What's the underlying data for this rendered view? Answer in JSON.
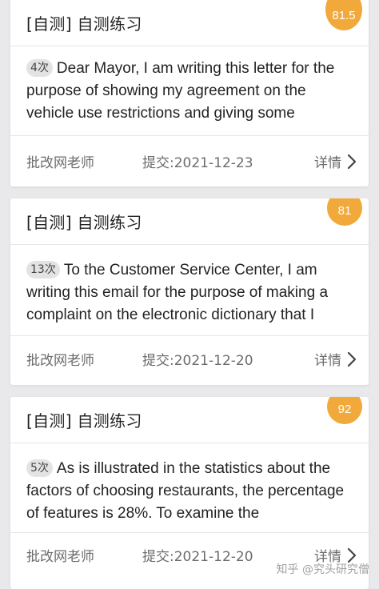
{
  "accent_color": "#f2a93b",
  "cards": [
    {
      "title": "[自测] 自测练习",
      "score": "81.5",
      "count": "4次",
      "excerpt": "Dear Mayor, I am writing this letter for the purpose of showing my agreement on the vehicle use restrictions and giving some",
      "teacher": "批改网老师",
      "submitted": "提交:2021-12-23",
      "detail": "详情"
    },
    {
      "title": "[自测] 自测练习",
      "score": "81",
      "count": "13次",
      "excerpt": "To the Customer Service Center, I am writing this email for the purpose of making a complaint on the electronic dictionary that I",
      "teacher": "批改网老师",
      "submitted": "提交:2021-12-20",
      "detail": "详情"
    },
    {
      "title": "[自测] 自测练习",
      "score": "92",
      "count": "5次",
      "excerpt": "As is illustrated in the statistics about the factors of choosing restaurants, the percentage of features is 28%. To examine the",
      "teacher": "批改网老师",
      "submitted": "提交:2021-12-20",
      "detail": "详情"
    }
  ],
  "watermark": "知乎 @究头研究僧"
}
